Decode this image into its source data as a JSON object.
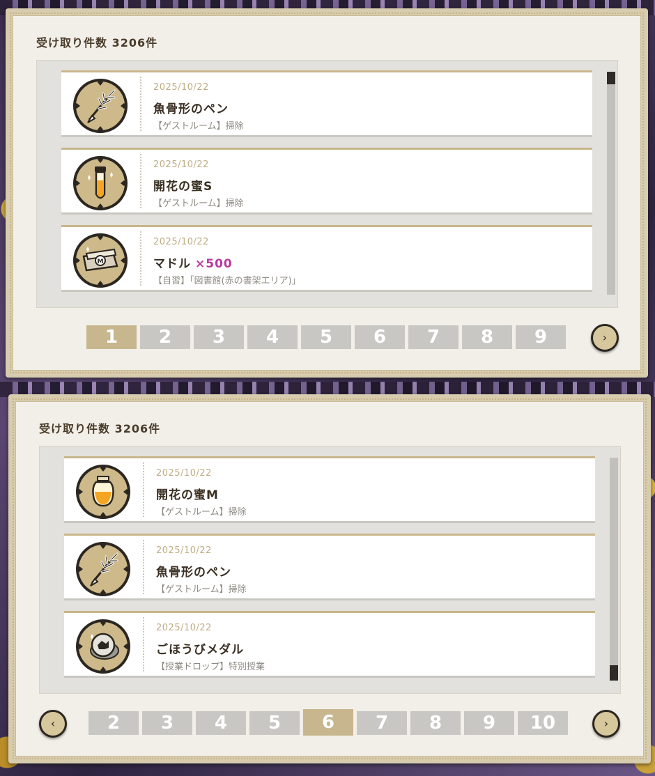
{
  "top": {
    "count_label": "受け取り件数 3206件",
    "items": [
      {
        "icon": "fishbone-pen-icon",
        "date": "2025/10/22",
        "name": "魚骨形のペン",
        "qty": "",
        "source": "【ゲストルーム】掃除"
      },
      {
        "icon": "honey-vial-icon",
        "date": "2025/10/22",
        "name": "開花の蜜S",
        "qty": "",
        "source": "【ゲストルーム】掃除"
      },
      {
        "icon": "madol-money-icon",
        "date": "2025/10/22",
        "name": "マドル",
        "qty": "×500",
        "source": "【自習】「図書館(赤の書架エリア)」"
      }
    ],
    "pages": [
      "1",
      "2",
      "3",
      "4",
      "5",
      "6",
      "7",
      "8",
      "9"
    ],
    "active_page": "1",
    "next_icon": "›"
  },
  "bottom": {
    "count_label": "受け取り件数 3206件",
    "items": [
      {
        "icon": "honey-jar-icon",
        "date": "2025/10/22",
        "name": "開花の蜜M",
        "qty": "",
        "source": "【ゲストルーム】掃除"
      },
      {
        "icon": "fishbone-pen-icon",
        "date": "2025/10/22",
        "name": "魚骨形のペン",
        "qty": "",
        "source": "【ゲストルーム】掃除"
      },
      {
        "icon": "reward-medal-icon",
        "date": "2025/10/22",
        "name": "ごほうびメダル",
        "qty": "",
        "source": "【授業ドロップ】特別授業"
      }
    ],
    "pages": [
      "2",
      "3",
      "4",
      "5",
      "6",
      "7",
      "8",
      "9",
      "10"
    ],
    "active_page": "6",
    "prev_icon": "‹",
    "next_icon": "›"
  },
  "colors": {
    "panel_frame": "#d8ccae",
    "panel_inner": "#f2efe9",
    "date_text": "#c0ad84",
    "qty_text": "#b8379e",
    "pager_active": "#c7b68e",
    "pager_inactive": "#c9c7c3"
  }
}
